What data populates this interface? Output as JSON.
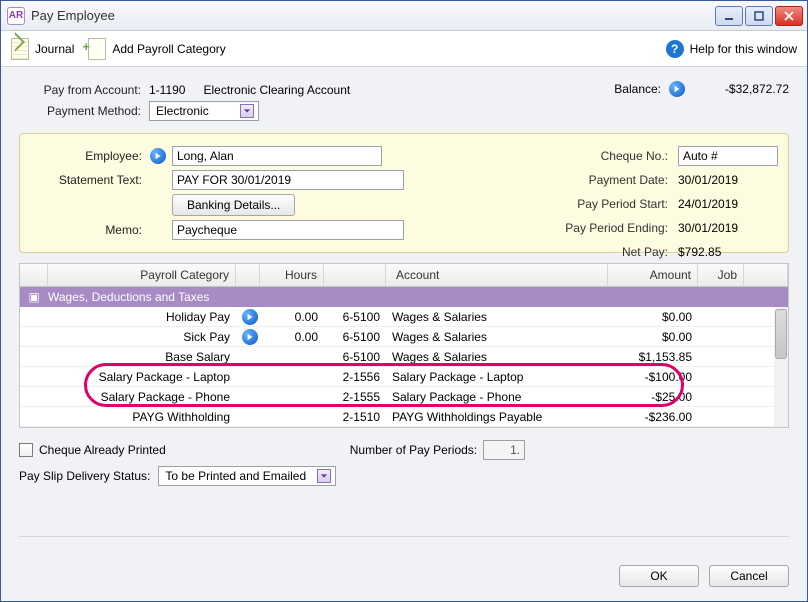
{
  "window": {
    "title": "Pay Employee"
  },
  "toolbar": {
    "journal": "Journal",
    "add_cat": "Add Payroll Category",
    "help": "Help for this window"
  },
  "top": {
    "pay_from_label": "Pay from Account:",
    "pay_from_code": "1-1190",
    "pay_from_name": "Electronic Clearing Account",
    "balance_label": "Balance:",
    "balance_value": "-$32,872.72",
    "payment_method_label": "Payment Method:",
    "payment_method_value": "Electronic"
  },
  "panel": {
    "employee_label": "Employee:",
    "employee_value": "Long, Alan",
    "statement_label": "Statement Text:",
    "statement_value": "PAY FOR 30/01/2019",
    "banking_btn": "Banking Details...",
    "memo_label": "Memo:",
    "memo_value": "Paycheque",
    "cheque_label": "Cheque No.:",
    "cheque_value": "Auto #",
    "payment_date_label": "Payment Date:",
    "payment_date_value": "30/01/2019",
    "period_start_label": "Pay Period Start:",
    "period_start_value": "24/01/2019",
    "period_end_label": "Pay Period Ending:",
    "period_end_value": "30/01/2019",
    "net_pay_label": "Net Pay:",
    "net_pay_value": "$792.85"
  },
  "grid": {
    "headers": {
      "category": "Payroll Category",
      "hours": "Hours",
      "account": "Account",
      "amount": "Amount",
      "job": "Job"
    },
    "group_label": "Wages, Deductions and Taxes",
    "rows": [
      {
        "cat": "Holiday Pay",
        "arrow": true,
        "hours": "0.00",
        "acct": "6-5100",
        "name": "Wages & Salaries",
        "amt": "$0.00"
      },
      {
        "cat": "Sick Pay",
        "arrow": true,
        "hours": "0.00",
        "acct": "6-5100",
        "name": "Wages & Salaries",
        "amt": "$0.00"
      },
      {
        "cat": "Base Salary",
        "arrow": false,
        "hours": "",
        "acct": "6-5100",
        "name": "Wages & Salaries",
        "amt": "$1,153.85"
      },
      {
        "cat": "Salary Package - Laptop",
        "arrow": false,
        "hours": "",
        "acct": "2-1556",
        "name": "Salary Package - Laptop",
        "amt": "-$100.00"
      },
      {
        "cat": "Salary Package - Phone",
        "arrow": false,
        "hours": "",
        "acct": "2-1555",
        "name": "Salary Package - Phone",
        "amt": "-$25.00"
      },
      {
        "cat": "PAYG Withholding",
        "arrow": false,
        "hours": "",
        "acct": "2-1510",
        "name": "PAYG Withholdings Payable",
        "amt": "-$236.00"
      }
    ]
  },
  "lower": {
    "cheque_printed_label": "Cheque Already Printed",
    "num_periods_label": "Number of Pay Periods:",
    "num_periods_value": "1.",
    "delivery_label": "Pay Slip Delivery Status:",
    "delivery_value": "To be Printed and Emailed"
  },
  "footer": {
    "ok": "OK",
    "cancel": "Cancel"
  }
}
